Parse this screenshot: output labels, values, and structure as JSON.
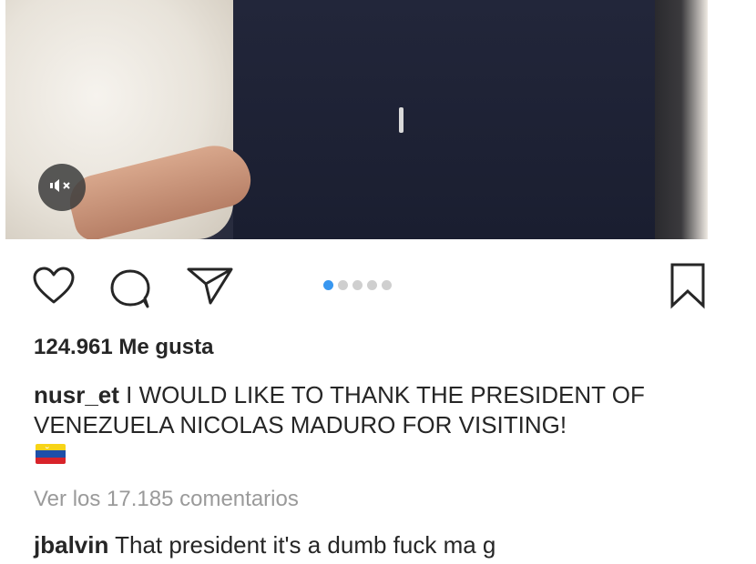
{
  "post": {
    "media": {
      "mute_icon": "speaker-muted-icon",
      "carousel_count": 5,
      "carousel_active_index": 0
    },
    "actions": {
      "like_icon": "heart-icon",
      "comment_icon": "comment-bubble-icon",
      "share_icon": "paper-plane-icon",
      "save_icon": "bookmark-icon"
    },
    "likes_text": "124.961 Me gusta",
    "caption": {
      "username": "nusr_et",
      "text": " I WOULD LIKE TO THANK THE PRESIDENT OF VENEZUELA NICOLAS MADURO FOR VISITING!",
      "emoji": "venezuela-flag-emoji"
    },
    "view_comments_text": "Ver los 17.185 comentarios",
    "top_comment": {
      "username": "jbalvin",
      "text": " That president it's a dumb fuck ma g"
    }
  },
  "colors": {
    "accent_blue": "#3897f0",
    "text": "#262626",
    "muted": "#9a9a9a"
  }
}
